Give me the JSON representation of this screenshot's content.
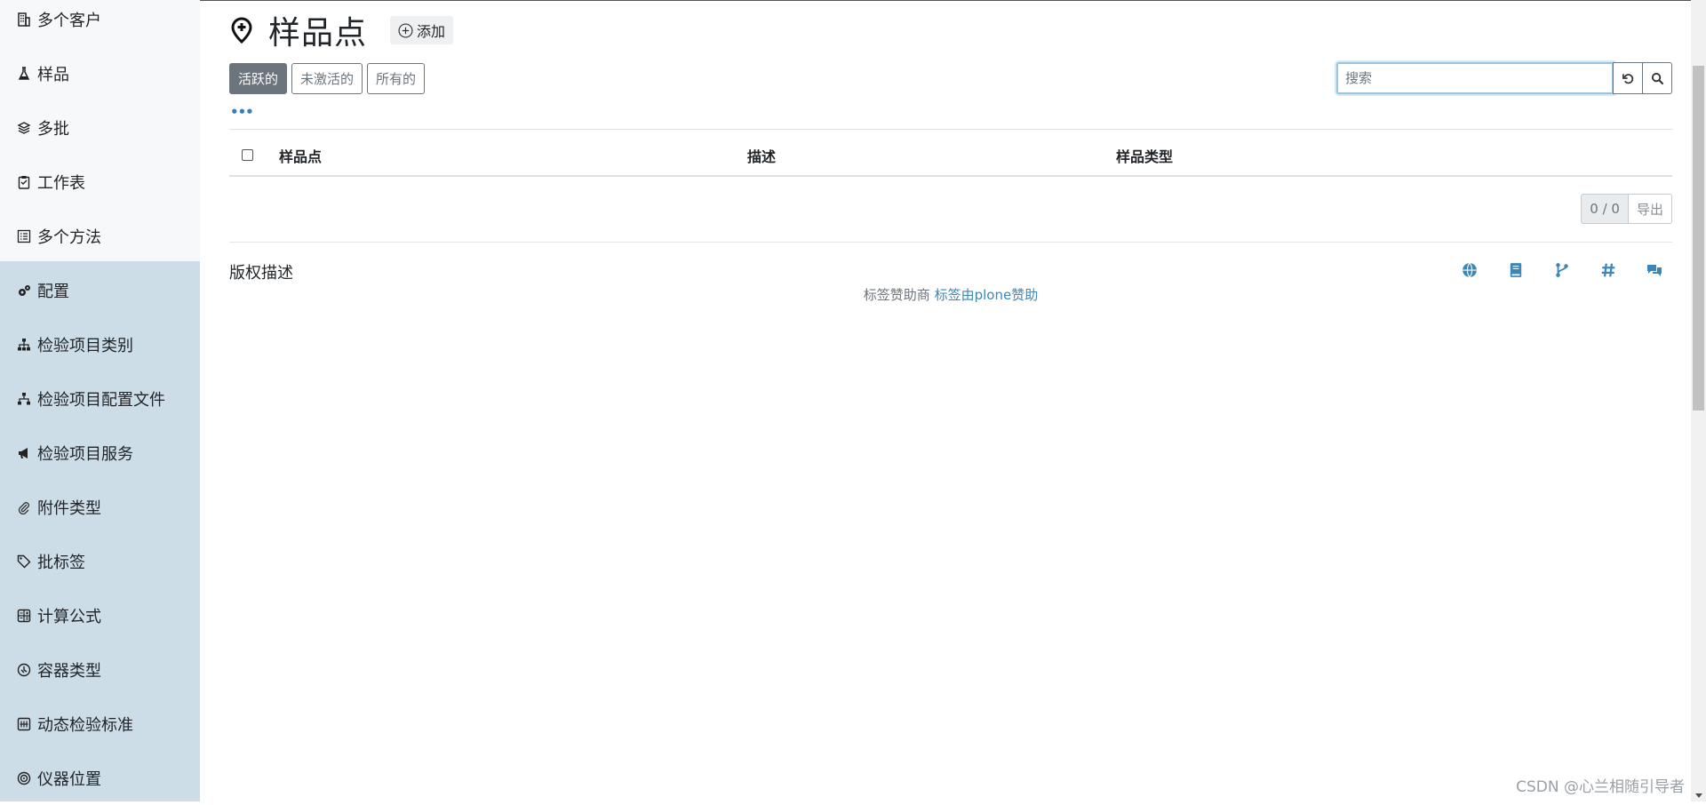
{
  "sidebar": {
    "items": [
      {
        "label": "多个客户",
        "icon": "building-icon"
      },
      {
        "label": "样品",
        "icon": "flask-icon"
      },
      {
        "label": "多批",
        "icon": "layers-icon"
      },
      {
        "label": "工作表",
        "icon": "clipboard-icon"
      },
      {
        "label": "多个方法",
        "icon": "list-check-icon"
      },
      {
        "label": "配置",
        "icon": "gears-icon"
      },
      {
        "label": "检验项目类别",
        "icon": "sitemap-icon"
      },
      {
        "label": "检验项目配置文件",
        "icon": "sitemap-icon"
      },
      {
        "label": "检验项目服务",
        "icon": "bullhorn-icon"
      },
      {
        "label": "附件类型",
        "icon": "paperclip-icon"
      },
      {
        "label": "批标签",
        "icon": "tags-icon"
      },
      {
        "label": "计算公式",
        "icon": "calculator-icon"
      },
      {
        "label": "容器类型",
        "icon": "container-icon"
      },
      {
        "label": "动态检验标准",
        "icon": "table-icon"
      },
      {
        "label": "仪器位置",
        "icon": "location-icon"
      }
    ]
  },
  "header": {
    "title": "样品点",
    "title_icon": "map-pin-icon",
    "add_label": "添加"
  },
  "filters": [
    "活跃的",
    "未激活的",
    "所有的"
  ],
  "search": {
    "placeholder": "搜索",
    "value": ""
  },
  "ellipsis": "•••",
  "table": {
    "columns": [
      "样品点",
      "描述",
      "样品类型"
    ],
    "rows": []
  },
  "pager": {
    "count": "0 / 0",
    "export_label": "导出"
  },
  "footer": {
    "copyright": "版权描述",
    "credit_prefix": "标签赞助商",
    "credit_link": "标签由plone赞助",
    "icons": [
      "globe-icon",
      "book-icon",
      "code-branch-icon",
      "hashtag-icon",
      "comments-icon"
    ]
  },
  "watermark": "CSDN @心兰相随引导者",
  "colors": {
    "sidebar_bg": "#f7f8f9",
    "config_bg": "#cddde7",
    "accent": "#3d87b8",
    "active_filter": "#6c757d"
  }
}
